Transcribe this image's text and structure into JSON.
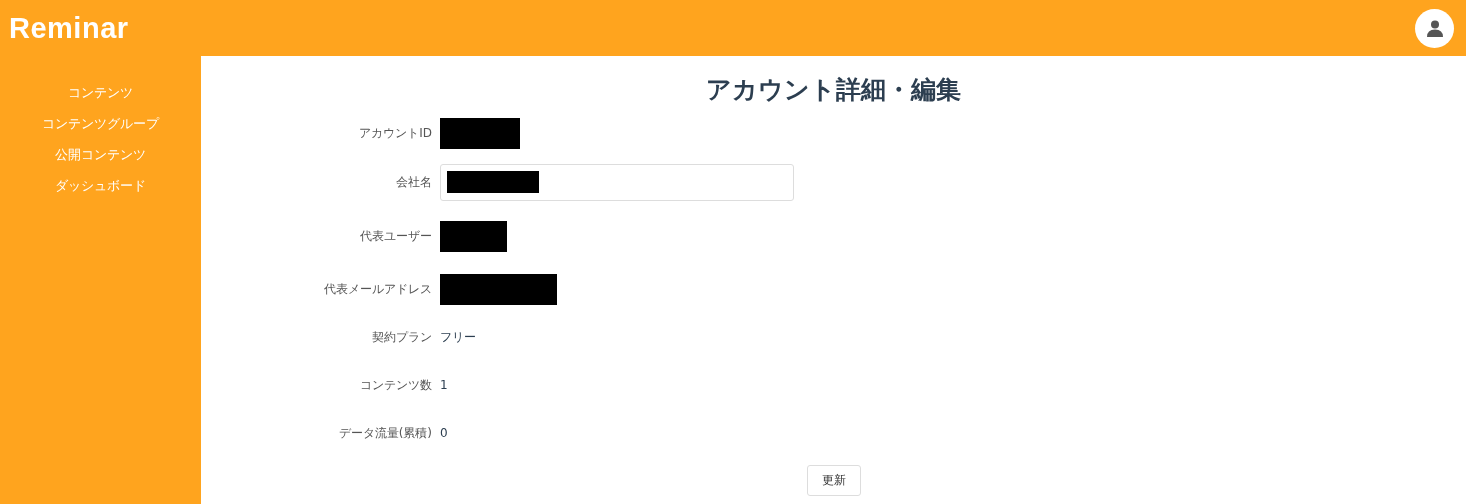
{
  "header": {
    "logo": "Reminar"
  },
  "sidebar": {
    "items": [
      {
        "label": "コンテンツ"
      },
      {
        "label": "コンテンツグループ"
      },
      {
        "label": "公開コンテンツ"
      },
      {
        "label": "ダッシュボード"
      }
    ]
  },
  "page": {
    "title": "アカウント詳細・編集",
    "rows": [
      {
        "label": "アカウントID",
        "kind": "redacted"
      },
      {
        "label": "会社名",
        "kind": "redacted-input"
      },
      {
        "label": "代表ユーザー",
        "kind": "redacted"
      },
      {
        "label": "代表メールアドレス",
        "kind": "redacted"
      },
      {
        "label": "契約プラン",
        "kind": "text",
        "value": "フリー"
      },
      {
        "label": "コンテンツ数",
        "kind": "text",
        "value": "1"
      },
      {
        "label": "データ流量(累積)",
        "kind": "text",
        "value": "0"
      }
    ],
    "button": "更新"
  }
}
